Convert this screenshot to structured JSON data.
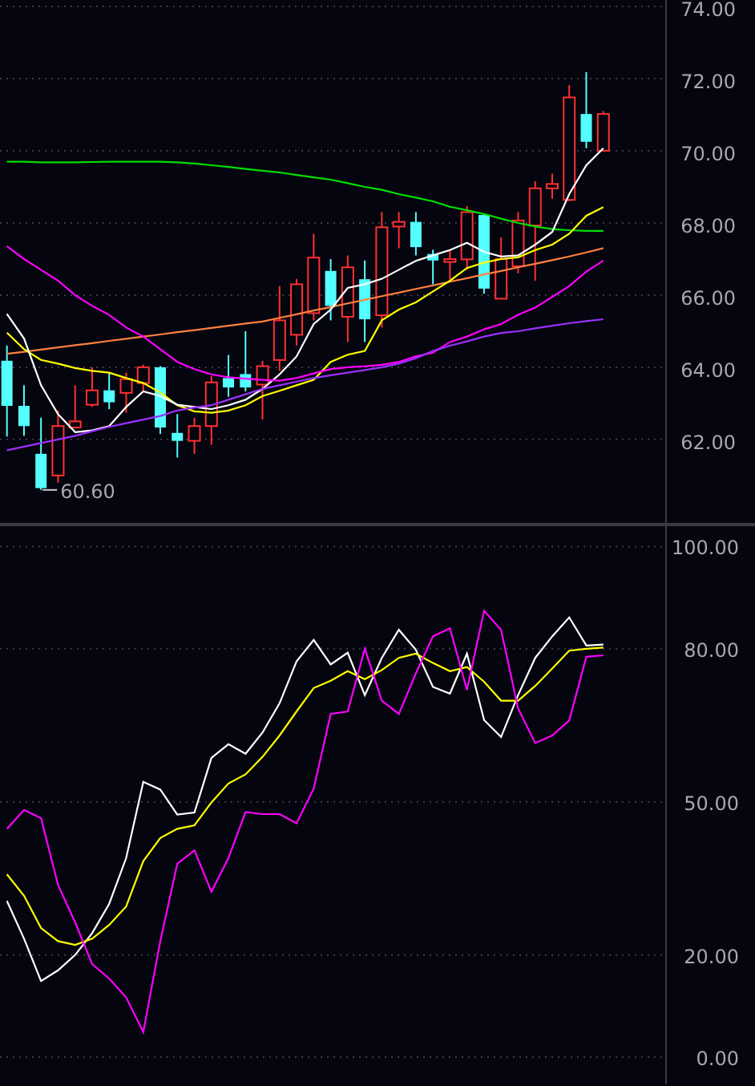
{
  "price_panel": {
    "chart_data": {
      "type": "candlestick",
      "grid": true,
      "ylim": [
        59.64,
        74.18
      ],
      "yticks": [
        {
          "value": 74,
          "label": "74.00"
        },
        {
          "value": 72,
          "label": "72.00"
        },
        {
          "value": 70,
          "label": "70.00"
        },
        {
          "value": 68,
          "label": "68.00"
        },
        {
          "value": 66,
          "label": "66.00"
        },
        {
          "value": 64,
          "label": "64.00"
        },
        {
          "value": 62,
          "label": "62.00"
        }
      ],
      "ohlc": [
        [
          64.18,
          64.6,
          62.08,
          62.93
        ],
        [
          62.93,
          63.5,
          62.1,
          62.37
        ],
        [
          61.6,
          62.6,
          60.6,
          60.65
        ],
        [
          61.0,
          62.8,
          60.8,
          62.37
        ],
        [
          62.33,
          63.5,
          62.3,
          62.5
        ],
        [
          62.96,
          64.0,
          62.9,
          63.36
        ],
        [
          63.36,
          63.85,
          62.84,
          63.03
        ],
        [
          63.29,
          63.85,
          62.74,
          63.67
        ],
        [
          63.56,
          64.07,
          63.33,
          64.0
        ],
        [
          64.0,
          64.03,
          62.15,
          62.33
        ],
        [
          62.18,
          62.7,
          61.5,
          61.96
        ],
        [
          61.96,
          62.6,
          61.6,
          62.37
        ],
        [
          62.37,
          63.76,
          61.85,
          63.58
        ],
        [
          63.7,
          64.34,
          63.18,
          63.44
        ],
        [
          63.81,
          65.0,
          63.33,
          63.44
        ],
        [
          63.52,
          64.18,
          62.55,
          64.03
        ],
        [
          64.2,
          66.25,
          63.9,
          65.3
        ],
        [
          64.9,
          66.45,
          64.6,
          66.3
        ],
        [
          65.5,
          67.7,
          65.3,
          67.04
        ],
        [
          66.67,
          67.0,
          65.3,
          65.7
        ],
        [
          65.4,
          67.1,
          64.7,
          66.77
        ],
        [
          66.44,
          66.96,
          64.7,
          65.33
        ],
        [
          65.44,
          68.3,
          65.1,
          67.88
        ],
        [
          67.9,
          68.3,
          67.3,
          68.03
        ],
        [
          68.03,
          68.3,
          67.1,
          67.33
        ],
        [
          67.14,
          67.26,
          66.3,
          66.96
        ],
        [
          66.92,
          67.26,
          66.44,
          67.0
        ],
        [
          66.99,
          68.47,
          66.7,
          68.3
        ],
        [
          68.22,
          68.22,
          66.04,
          66.18
        ],
        [
          65.9,
          67.6,
          65.9,
          67.0
        ],
        [
          66.8,
          68.3,
          66.6,
          68.07
        ],
        [
          67.93,
          69.16,
          66.4,
          68.96
        ],
        [
          68.96,
          69.37,
          68.67,
          69.08
        ],
        [
          68.64,
          71.82,
          68.6,
          71.48
        ],
        [
          71.02,
          72.18,
          70.07,
          70.25
        ],
        [
          70.0,
          71.1,
          70.0,
          71.02
        ]
      ],
      "series": [
        {
          "type": "line",
          "color": "#00e000",
          "values": [
            69.7,
            69.7,
            69.68,
            69.68,
            69.68,
            69.69,
            69.7,
            69.7,
            69.7,
            69.7,
            69.68,
            69.65,
            69.6,
            69.55,
            69.5,
            69.45,
            69.4,
            69.33,
            69.26,
            69.2,
            69.1,
            69.0,
            68.92,
            68.8,
            68.7,
            68.6,
            68.45,
            68.35,
            68.25,
            68.12,
            68.0,
            67.9,
            67.83,
            67.8,
            67.78,
            67.78
          ]
        },
        {
          "type": "line",
          "color": "#ff8040",
          "values": [
            64.37,
            64.43,
            64.49,
            64.55,
            64.61,
            64.67,
            64.73,
            64.79,
            64.85,
            64.91,
            64.97,
            65.03,
            65.09,
            65.15,
            65.21,
            65.27,
            65.37,
            65.47,
            65.57,
            65.67,
            65.77,
            65.87,
            65.97,
            66.07,
            66.17,
            66.27,
            66.37,
            66.47,
            66.57,
            66.67,
            66.77,
            66.87,
            66.97,
            67.07,
            67.18,
            67.3
          ]
        },
        {
          "type": "line",
          "color": "#ffff00",
          "values": [
            64.96,
            64.5,
            64.2,
            64.1,
            63.98,
            63.9,
            63.85,
            63.7,
            63.56,
            63.3,
            62.95,
            62.78,
            62.74,
            62.8,
            62.95,
            63.2,
            63.35,
            63.5,
            63.65,
            64.15,
            64.35,
            64.45,
            65.3,
            65.6,
            65.8,
            66.1,
            66.4,
            66.75,
            66.9,
            67.0,
            67.05,
            67.25,
            67.4,
            67.7,
            68.2,
            68.44
          ]
        },
        {
          "type": "line",
          "color": "#ffffff",
          "values": [
            65.48,
            64.8,
            63.5,
            62.7,
            62.2,
            62.25,
            62.37,
            62.9,
            63.33,
            63.2,
            62.96,
            62.9,
            62.84,
            62.95,
            63.1,
            63.4,
            63.8,
            64.3,
            65.2,
            65.6,
            66.2,
            66.3,
            66.45,
            66.7,
            66.95,
            67.1,
            67.25,
            67.45,
            67.2,
            67.07,
            67.1,
            67.4,
            67.75,
            68.8,
            69.6,
            70.07
          ]
        },
        {
          "type": "line",
          "color": "#ff00ff",
          "values": [
            67.36,
            67.0,
            66.7,
            66.4,
            66.0,
            65.7,
            65.45,
            65.1,
            64.85,
            64.5,
            64.15,
            63.95,
            63.8,
            63.72,
            63.68,
            63.65,
            63.63,
            63.7,
            63.83,
            63.95,
            64.0,
            64.03,
            64.07,
            64.15,
            64.3,
            64.4,
            64.7,
            64.85,
            65.05,
            65.2,
            65.45,
            65.65,
            65.95,
            66.25,
            66.65,
            66.96
          ]
        },
        {
          "type": "line",
          "color": "#9b30ff",
          "values": [
            61.7,
            61.8,
            61.9,
            62.0,
            62.1,
            62.23,
            62.35,
            62.45,
            62.55,
            62.65,
            62.8,
            62.88,
            62.95,
            63.1,
            63.25,
            63.4,
            63.5,
            63.6,
            63.7,
            63.78,
            63.85,
            63.92,
            64.0,
            64.1,
            64.25,
            64.45,
            64.6,
            64.72,
            64.85,
            64.95,
            65.0,
            65.08,
            65.15,
            65.22,
            65.28,
            65.33
          ]
        }
      ],
      "annotations": [
        "60.60"
      ]
    }
  },
  "indicator_panel": {
    "chart_data": {
      "type": "line",
      "grid": true,
      "ylim": [
        -5.34,
        104.3
      ],
      "yticks": [
        {
          "value": 100,
          "label": "100.00"
        },
        {
          "value": 80,
          "label": "80.00"
        },
        {
          "value": 50,
          "label": "50.00"
        },
        {
          "value": 20,
          "label": "20.00"
        },
        {
          "value": 0,
          "label": "0.00"
        }
      ],
      "series": [
        {
          "color": "#ffffff",
          "values": [
            30.6,
            23.2,
            14.9,
            17,
            20,
            24.3,
            30,
            39,
            53.9,
            52.4,
            47.5,
            47.9,
            58.6,
            61.3,
            59.4,
            63.6,
            69.3,
            77.5,
            81.7,
            76.9,
            79.2,
            70.9,
            78.2,
            83.7,
            79.8,
            72.5,
            71.2,
            79,
            66,
            62.7,
            70.9,
            78.2,
            82.4,
            86.1,
            80.6,
            80.8
          ]
        },
        {
          "color": "#ffff00",
          "values": [
            35.8,
            31.6,
            25.3,
            22.7,
            22,
            23.2,
            25.9,
            29.5,
            38.4,
            42.9,
            44.7,
            45.4,
            49.9,
            53.6,
            55.4,
            58.8,
            63,
            67.7,
            72.3,
            73.7,
            75.6,
            74,
            75.8,
            78.2,
            79,
            77.2,
            75.6,
            76.4,
            73.5,
            69.8,
            69.8,
            72.7,
            76.1,
            79.6,
            80,
            80.2
          ]
        },
        {
          "color": "#ff00ff",
          "values": [
            44.7,
            48.4,
            46.8,
            33.7,
            26.4,
            18.2,
            15.4,
            11.7,
            4.9,
            22.7,
            37.9,
            40.5,
            32.4,
            39,
            48,
            47.6,
            47.6,
            45.8,
            52.6,
            67.2,
            67.7,
            80,
            69.8,
            67.2,
            75.1,
            82.4,
            84,
            71.9,
            87.4,
            83.7,
            68.3,
            61.5,
            63,
            65.9,
            78.4,
            78.7
          ]
        }
      ]
    }
  }
}
